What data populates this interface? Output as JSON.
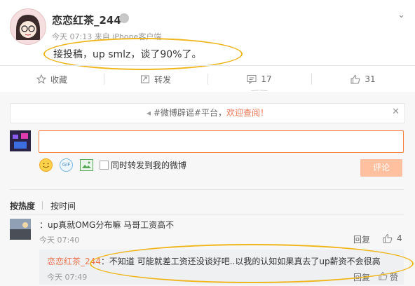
{
  "colors": {
    "accent": "#fa7d3c",
    "highlight": "#eb7350",
    "annotation": "#f0b51a",
    "submit_bg": "#ffc09f"
  },
  "post": {
    "author": "恋恋红茶_244",
    "meta": "今天 07:13 来自 iPhone客户端",
    "content": "接投稿，up smlz，谈了90%了。",
    "vip_icon": "badge-icon",
    "menu_icon": "chevron-down-icon"
  },
  "actions": [
    {
      "icon": "star-icon",
      "label": "收藏"
    },
    {
      "icon": "forward-icon",
      "label": "转发"
    },
    {
      "icon": "comment-icon",
      "label": "17"
    },
    {
      "icon": "thumbs-up-icon",
      "label": "31"
    }
  ],
  "notice": {
    "hashtag": "#微博辟谣#平台，",
    "highlight": "欢迎查阅！",
    "lead_icon": "megaphone-icon"
  },
  "composer": {
    "emoji_icon": "emoji-icon",
    "gif_icon": "gif-icon",
    "gif_label": "GIF",
    "image_icon": "image-icon",
    "checkbox_label": "同时转发到我的微博",
    "submit_label": "评论"
  },
  "sort_tabs": [
    "按热度",
    "按时间"
  ],
  "comments": [
    {
      "user": "",
      "text": "：up真就OMG分布嘛 马哥工资高不",
      "time": "今天 07:40",
      "reply_label": "回复",
      "like_count": "4",
      "reply": {
        "user": "恋恋红茶_244",
        "text": "：不知道 可能就差工资还没谈好吧..以我的认知如果真去了up薪资不会很高",
        "time": "今天 07:49",
        "reply_label": "回复",
        "like_label": "赞"
      }
    }
  ]
}
